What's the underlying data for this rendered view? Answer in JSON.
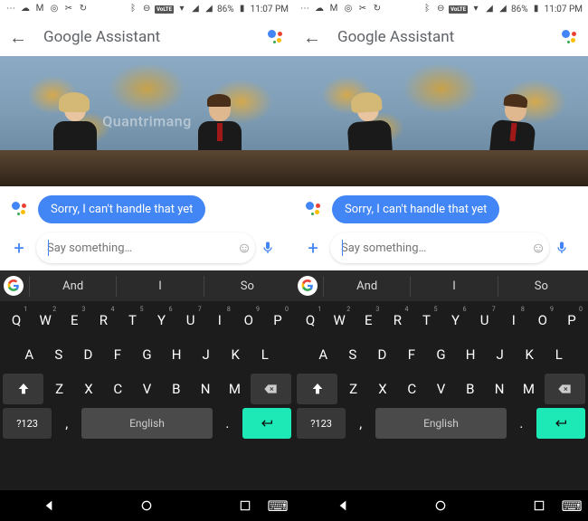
{
  "status": {
    "battery": "86%",
    "time": "11:07 PM",
    "volte": "VoLTE"
  },
  "appbar": {
    "title": "Google Assistant"
  },
  "chat": {
    "assistant_message": "Sorry, I can't handle that yet"
  },
  "input": {
    "placeholder": "Say something…",
    "value": ""
  },
  "suggestions": [
    "And",
    "I",
    "So"
  ],
  "keyboard": {
    "row1": [
      {
        "k": "Q",
        "n": "1"
      },
      {
        "k": "W",
        "n": "2"
      },
      {
        "k": "E",
        "n": "3"
      },
      {
        "k": "R",
        "n": "4"
      },
      {
        "k": "T",
        "n": "5"
      },
      {
        "k": "Y",
        "n": "6"
      },
      {
        "k": "U",
        "n": "7"
      },
      {
        "k": "I",
        "n": "8"
      },
      {
        "k": "O",
        "n": "9"
      },
      {
        "k": "P",
        "n": "0"
      }
    ],
    "row2": [
      "A",
      "S",
      "D",
      "F",
      "G",
      "H",
      "J",
      "K",
      "L"
    ],
    "row3": [
      "Z",
      "X",
      "C",
      "V",
      "B",
      "N",
      "M"
    ],
    "symbol_key": "?123",
    "comma": ",",
    "period": ".",
    "space_label": "English"
  },
  "watermark": "Quantrimang"
}
